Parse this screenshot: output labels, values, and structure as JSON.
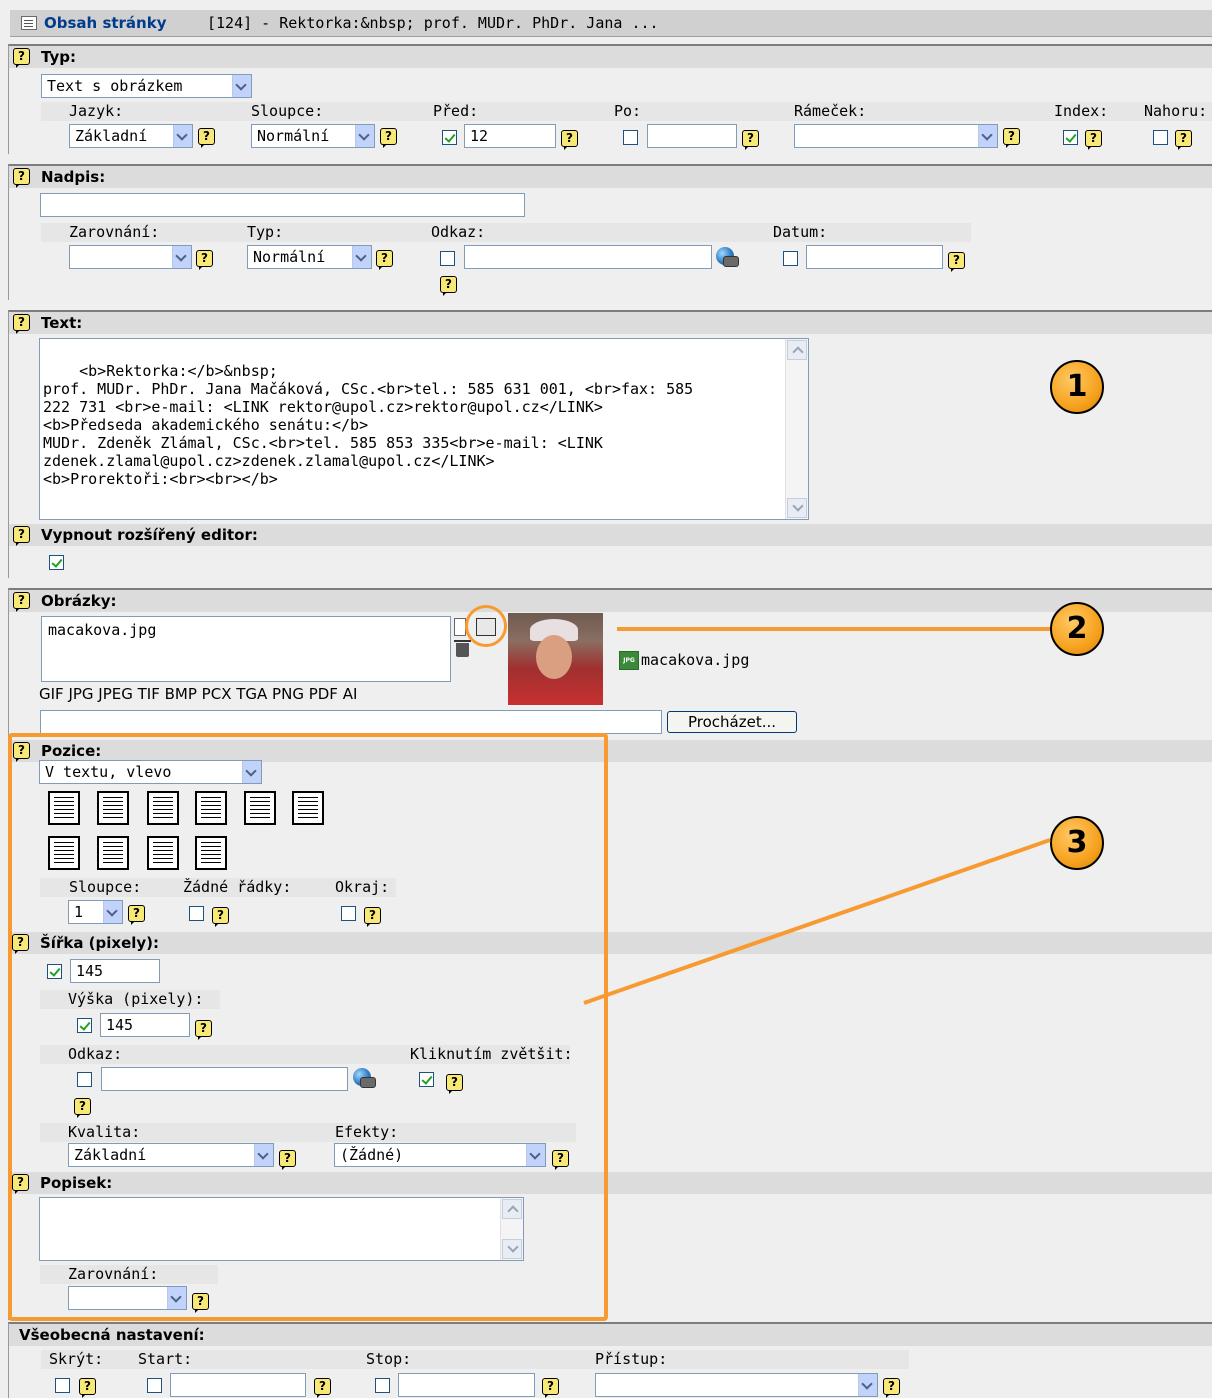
{
  "window": {
    "title": "Obsah stránky",
    "title_rest": "[124] - Rektorka:&nbsp; prof. MUDr. PhDr. Jana ..."
  },
  "typ": {
    "heading": "Typ:",
    "type_value": "Text s obrázkem",
    "labels": {
      "jazyk": "Jazyk:",
      "sloupce": "Sloupce:",
      "pred": "Před:",
      "po": "Po:",
      "ramecek": "Rámeček:",
      "index": "Index:",
      "nahoru": "Nahoru:"
    },
    "jazyk_value": "Základní",
    "sloupce_value": "Normální",
    "pred_value": "12",
    "pred_checked": true,
    "po_checked": false,
    "index_checked": true,
    "nahoru_checked": false
  },
  "nadpis": {
    "heading": "Nadpis:",
    "labels": {
      "zarovnani": "Zarovnání:",
      "typ": "Typ:",
      "odkaz": "Odkaz:",
      "datum": "Datum:"
    },
    "typ_value": "Normální"
  },
  "text": {
    "heading": "Text:",
    "body": "<b>Rektorka:</b>&nbsp;\nprof. MUDr. PhDr. Jana Mačáková, CSc.<br>tel.: 585 631 001, <br>fax: 585\n222 731 <br>e-mail: <LINK rektor@upol.cz>rektor@upol.cz</LINK>\n<b>Předseda akademického senátu:</b>\nMUDr. Zdeněk Zlámal, CSc.<br>tel. 585 853 335<br>e-mail: <LINK\nzdenek.zlamal@upol.cz>zdenek.zlamal@upol.cz</LINK>\n<b>Prorektoři:<br><br></b>",
    "disable_editor_label": "Vypnout rozšířený editor:",
    "disable_editor_checked": true
  },
  "obrazky": {
    "heading": "Obrázky:",
    "file_list": "macakova.jpg",
    "thumb_caption": "macakova.jpg",
    "formats": "GIF JPG JPEG TIF BMP PCX TGA PNG PDF AI",
    "browse": "Procházet..."
  },
  "pozice": {
    "heading": "Pozice:",
    "value": "V textu, vlevo",
    "labels": {
      "sloupce": "Sloupce:",
      "zadne": "Žádné řádky:",
      "okraj": "Okraj:"
    },
    "sloupce_value": "1"
  },
  "sirka": {
    "heading": "Šířka (pixely):",
    "width_checked": true,
    "width_value": "145",
    "height_label": "Výška (pixely):",
    "height_checked": true,
    "height_value": "145",
    "odkaz_label": "Odkaz:",
    "click_label": "Kliknutím zvětšit:",
    "click_checked": true,
    "kvalita_label": "Kvalita:",
    "kvalita_value": "Základní",
    "efekty_label": "Efekty:",
    "efekty_value": "(Žádné)"
  },
  "popisek": {
    "heading": "Popisek:",
    "zarovnani_label": "Zarovnání:"
  },
  "general": {
    "heading": "Všeobecná nastavení:",
    "labels": {
      "skryt": "Skrýt:",
      "start": "Start:",
      "stop": "Stop:",
      "pristup": "Přístup:"
    }
  },
  "annotations": {
    "one": "1",
    "two": "2",
    "three": "3"
  },
  "colors": {
    "accent": "#f79a32",
    "title_blue": "#003c8c"
  },
  "help_glyph": "?"
}
